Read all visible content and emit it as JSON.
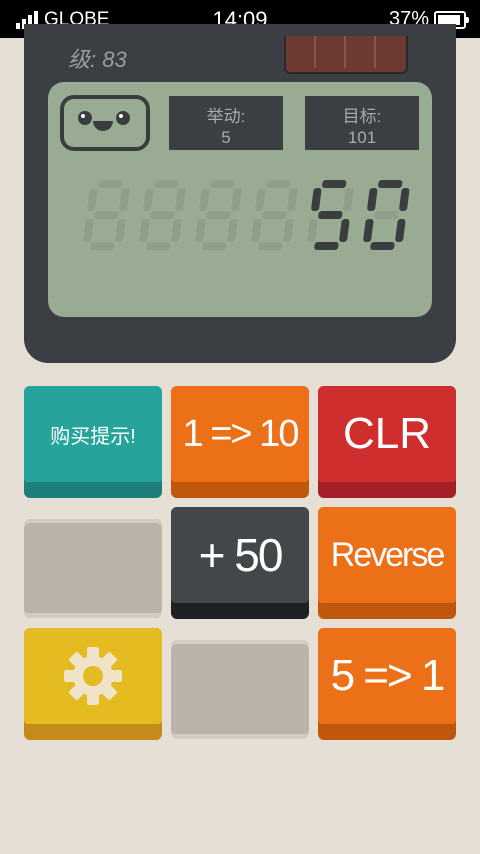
{
  "status_bar": {
    "carrier": "GLOBE",
    "time": "14:09",
    "battery_percent": "37%",
    "battery_level": 0.37
  },
  "calculator": {
    "level_label": "级: 83",
    "moves": {
      "label": "举动:",
      "value": "5"
    },
    "goal": {
      "label": "目标:",
      "value": "101"
    },
    "display_value": "50"
  },
  "buttons": {
    "hint": "购买提示!",
    "one_to_ten": "1 => 10",
    "clear": "CLR",
    "plus_fifty": "+ 50",
    "reverse": "Reverse",
    "five_to_one": "5 => 1",
    "settings_icon": "gear-icon"
  },
  "colors": {
    "background": "#e6dfd5",
    "calculator_body": "#3b3e42",
    "screen": "#9aab93",
    "teal": "#26a49c",
    "orange": "#ec7018",
    "red": "#cf2e2f",
    "dark": "#44474a",
    "yellow": "#e4bb20",
    "blank": "#bab3aa"
  }
}
